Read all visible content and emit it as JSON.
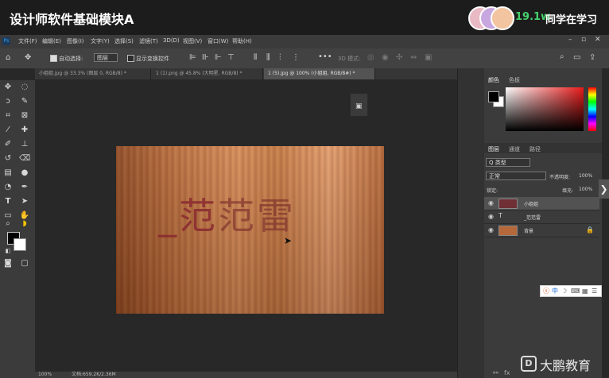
{
  "banner": {
    "title": "设计师软件基础模块A",
    "viewer_count": "19.1w",
    "viewer_text": "同学在学习"
  },
  "menubar": {
    "logo": "Ps",
    "items": [
      "文件(F)",
      "编辑(E)",
      "图像(I)",
      "文字(Y)",
      "选择(S)",
      "滤镜(T)",
      "3D(D)",
      "视图(V)",
      "窗口(W)",
      "帮助(H)"
    ]
  },
  "options": {
    "auto_select_label": "自动选择:",
    "auto_select_value": "图层",
    "show_transform_label": "显示变换控件",
    "mode_3d_label": "3D 模式:"
  },
  "tabs": [
    {
      "label": "小姐姐.jpg @ 33.3% (图层 0, RGB/8) *"
    },
    {
      "label": "1 (1).png @ 45.8% (大明星, RGB/8) *"
    },
    {
      "label": "1 (5).jpg @ 100% (小姐姐, RGB/8#) *"
    }
  ],
  "canvas": {
    "text_prefix": "_范",
    "text_mid": "范",
    "text_suffix": "雷"
  },
  "status": {
    "zoom": "100%",
    "doc_info": "文档:659.2K/2.36M"
  },
  "panels": {
    "color_tab": "颜色",
    "swatches_tab": "色板",
    "layers_tab": "图层",
    "channels_tab": "通道",
    "paths_tab": "路径",
    "kind_filter": "Q 类型",
    "blend_mode": "正常",
    "opacity_label": "不透明度:",
    "opacity_value": "100%",
    "lock_label": "锁定:",
    "fill_label": "填充:",
    "fill_value": "100%",
    "layers": [
      {
        "name": "小姐姐",
        "selected": true
      },
      {
        "name": "_范范雷",
        "selected": false
      },
      {
        "name": "背景",
        "selected": false
      }
    ]
  },
  "ime": {
    "label": "中"
  },
  "brand": {
    "name": "大鹏教育"
  },
  "colors": {
    "foreground": "#000000",
    "background": "#ffffff",
    "accent_green": "#47d06c"
  }
}
